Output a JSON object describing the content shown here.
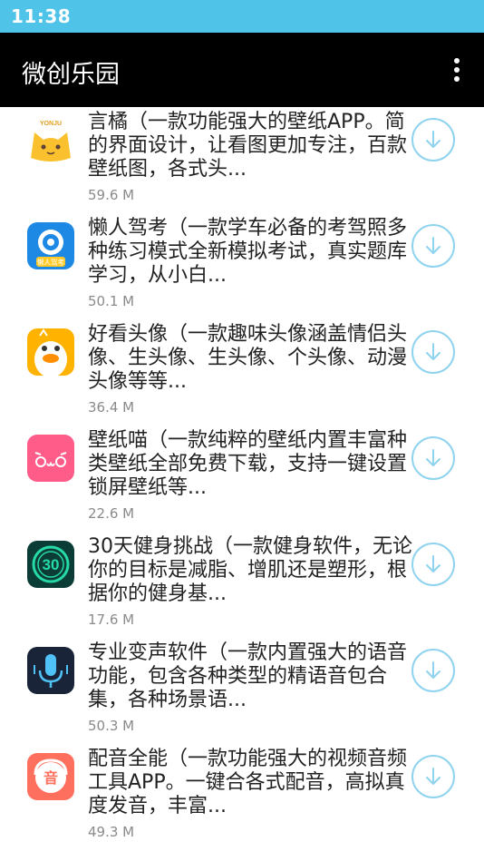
{
  "status_bar": {
    "time": "11:38"
  },
  "app_bar": {
    "title": "微创乐园"
  },
  "apps": [
    {
      "name": "言橘（一款功能强大的壁纸APP。简的界面设计，让看图更加专注，百款壁纸图，各式头...",
      "size": "59.6 M",
      "icon": "yanju-cat-icon",
      "icon_text": "YONJU"
    },
    {
      "name": "懒人驾考（一款学车必备的考驾照多种练习模式全新模拟考试，真实题库学习，从小白...",
      "size": "50.1 M",
      "icon": "lazy-driving-icon",
      "icon_text": "懒人驾考"
    },
    {
      "name": "好看头像（一款趣味头像涵盖情侣头像、生头像、生头像、个头像、动漫头像等等...",
      "size": "36.4 M",
      "icon": "duck-avatar-icon"
    },
    {
      "name": "壁纸喵（一款纯粹的壁纸内置丰富种类壁纸全部免费下载，支持一键设置锁屏壁纸等...",
      "size": "22.6 M",
      "icon": "wallpaper-cat-face-icon"
    },
    {
      "name": "30天健身挑战（一款健身软件，无论你的目标是减脂、增肌还是塑形，根据你的健身基...",
      "size": "17.6 M",
      "icon": "fitness-30-icon",
      "icon_text": "30"
    },
    {
      "name": "专业变声软件（一款内置强大的语音功能，包含各种类型的精语音包合集，各种场景语...",
      "size": "50.3 M",
      "icon": "microphone-icon"
    },
    {
      "name": "配音全能（一款功能强大的视频音频工具APP。一键合各式配音，高拟真度发音，丰富...",
      "size": "49.3 M",
      "icon": "dubbing-icon",
      "icon_text": "音"
    }
  ],
  "colors": {
    "status_bar": "#4fc3e8",
    "app_bar": "#000000",
    "download_ring": "#8fd3ef",
    "size_text": "#8a8a8a"
  },
  "download_icon": "download-arrow-icon"
}
